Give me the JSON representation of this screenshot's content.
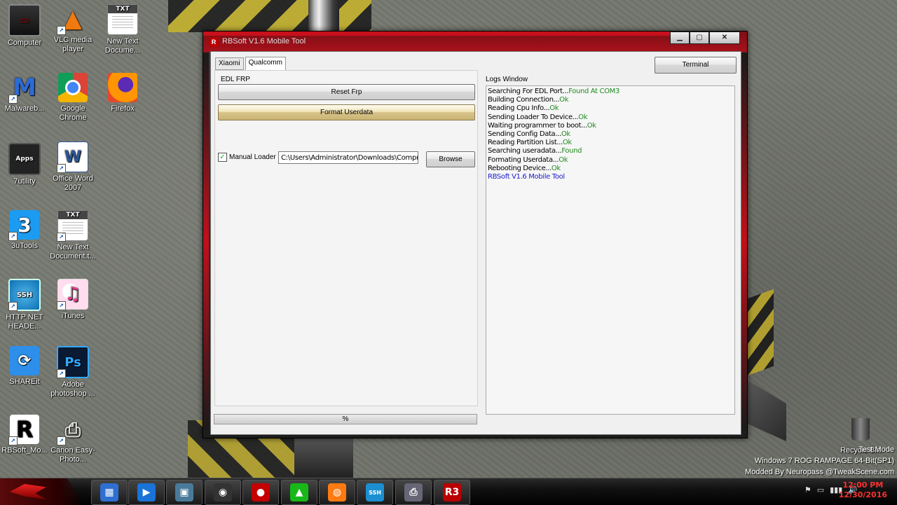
{
  "desktop": {
    "icons": [
      {
        "label": "Computer",
        "glyph": "▭"
      },
      {
        "label": "VLC media player",
        "glyph": "▲"
      },
      {
        "label": "New Text Docume...",
        "glyph": ""
      },
      {
        "label": "Malwareb...",
        "glyph": "M"
      },
      {
        "label": "Google Chrome",
        "glyph": ""
      },
      {
        "label": "Firefox",
        "glyph": ""
      },
      {
        "label": "7utility",
        "glyph": "Apps"
      },
      {
        "label": "Office Word 2007",
        "glyph": "W"
      },
      {
        "label": "3uTools",
        "glyph": "3"
      },
      {
        "label": "New Text Document.t...",
        "glyph": ""
      },
      {
        "label": "HTTP NET HEADE...",
        "glyph": "SSH"
      },
      {
        "label": "iTunes",
        "glyph": "♫"
      },
      {
        "label": "SHAREit",
        "glyph": "⟳"
      },
      {
        "label": "Adobe photoshop ...",
        "glyph": "Ps"
      },
      {
        "label": "RBSoft_Mo...",
        "glyph": "R"
      },
      {
        "label": "Canon Easy-Photo...",
        "glyph": "⎙"
      },
      {
        "label": "Recycle Bin",
        "glyph": ""
      }
    ],
    "shortcut_arrow": "↗",
    "test_mode": "Test Mode",
    "os_line": "Windows 7 ROG RAMPAGE 64-Bit(SP1)",
    "modded_line": "Modded By Neuropass @TweakScene.com"
  },
  "window": {
    "title": "RBSoft V1.6 Mobile Tool",
    "logo_text": "R",
    "controls": {
      "minimize": "▁",
      "maximize": "▢",
      "close": "✕"
    },
    "tabs": [
      {
        "label": "Xiaomi",
        "active": false
      },
      {
        "label": "Qualcomm",
        "active": true
      }
    ],
    "terminal_label": "Terminal",
    "edl_frp_label": "EDL FRP",
    "reset_frp_label": "Reset Frp",
    "format_userdata_label": "Format Userdata",
    "manual_loader": {
      "label": "Manual Loader",
      "checked": true,
      "check_glyph": "✓"
    },
    "loader_path": "C:\\Users\\Administrator\\Downloads\\Compres:",
    "browse_label": "Browse",
    "progress_label": "%",
    "logs_label": "Logs Window",
    "logs": [
      {
        "text": "Searching For EDL Port...",
        "status": "Found At COM3"
      },
      {
        "text": "Building Connection...",
        "status": "Ok"
      },
      {
        "text": "Reading Cpu Info...",
        "status": "Ok"
      },
      {
        "text": "Sending Loader To Device...",
        "status": "Ok"
      },
      {
        "text": "Waiting programmer to boot...",
        "status": "Ok"
      },
      {
        "text": "Sending Config Data...",
        "status": "Ok"
      },
      {
        "text": "Reading Partition List...",
        "status": "Ok"
      },
      {
        "text": "Searching useradata...",
        "status": "Found"
      },
      {
        "text": "Formating Userdata...",
        "status": "Ok"
      },
      {
        "text": "Rebooting Device...",
        "status": "Ok"
      },
      {
        "text": "RBSoft V1.6 Mobile Tool",
        "status": "",
        "brand": true
      }
    ],
    "colors": {
      "status_ok": "#1f8a1f",
      "brand_line": "#1a1ad0",
      "accent_red": "#c8101c"
    }
  },
  "taskbar": {
    "apps": [
      {
        "name": "explorer-icon",
        "glyph": "▦",
        "color": "#2e6fd1"
      },
      {
        "name": "media-player-icon",
        "glyph": "▶",
        "color": "#1a73d6"
      },
      {
        "name": "computer-monitor-icon",
        "glyph": "▣",
        "color": "#4a7a9a"
      },
      {
        "name": "camera-icon",
        "glyph": "◉",
        "color": "#333"
      },
      {
        "name": "record-icon",
        "glyph": "●",
        "color": "#c40000"
      },
      {
        "name": "green-triangle-icon",
        "glyph": "▲",
        "color": "#18b818"
      },
      {
        "name": "firefox-icon",
        "glyph": "◍",
        "color": "#ff7a10"
      },
      {
        "name": "ssh-icon",
        "glyph": "SSH",
        "color": "#1b8fd0"
      },
      {
        "name": "printer-icon",
        "glyph": "⎙",
        "color": "#667"
      },
      {
        "name": "rbsoft-icon",
        "glyph": "R3",
        "color": "#b00"
      }
    ],
    "tray_icons": [
      "⚑",
      "▭",
      "▮▮▮",
      "🔊"
    ],
    "time": "12:00 PM",
    "date": "12/30/2016"
  }
}
